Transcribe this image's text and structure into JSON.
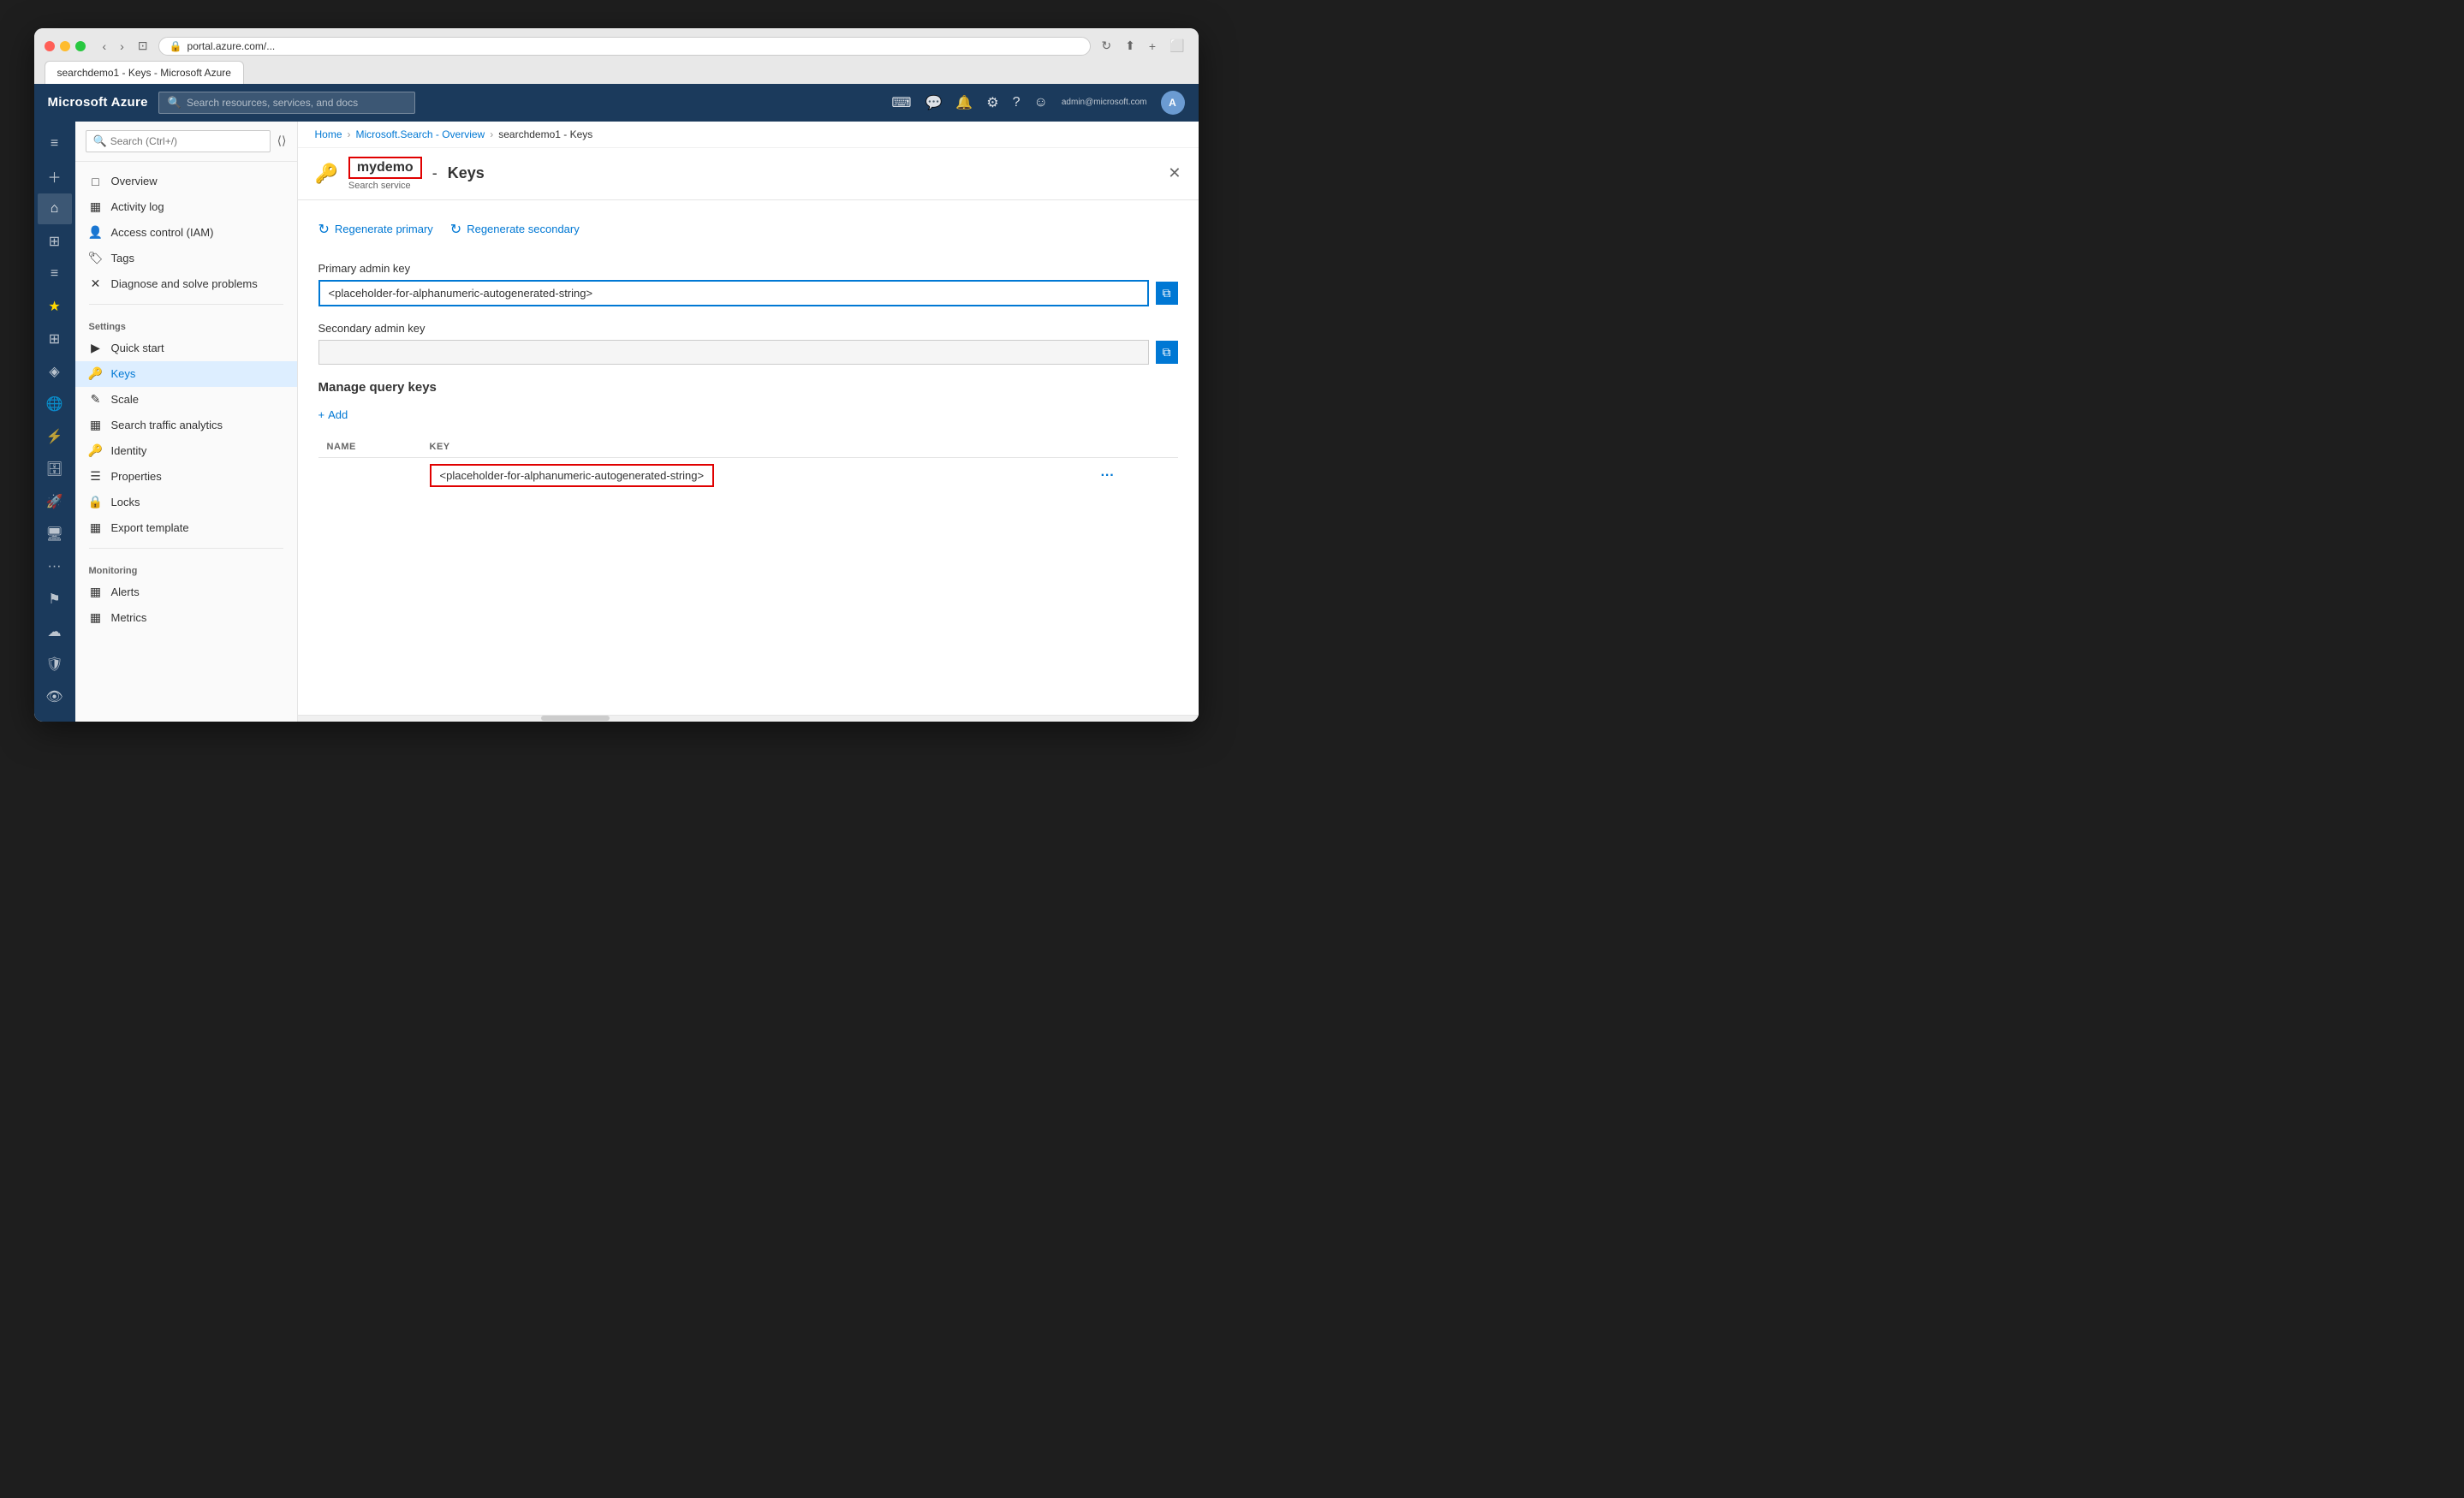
{
  "browser": {
    "url": "portal.azure.com/...",
    "tab_label": "searchdemo1 - Keys - Microsoft Azure"
  },
  "topnav": {
    "logo": "Microsoft Azure",
    "search_placeholder": "Search resources, services, and docs",
    "user_initials": "A",
    "user_email": "admin@microsoft.com"
  },
  "breadcrumb": {
    "items": [
      "Home",
      "Microsoft.Search - Overview",
      "searchdemo1 - Keys"
    ]
  },
  "page_header": {
    "service_name": "mydemo",
    "service_subtitle": "Search service",
    "dash": "-",
    "section": "Keys"
  },
  "toolbar": {
    "regen_primary": "Regenerate primary",
    "regen_secondary": "Regenerate secondary"
  },
  "primary_key_label": "Primary admin key",
  "primary_key_value": "<placeholder-for-alphanumeric-autogenerated-string>",
  "secondary_key_label": "Secondary admin key",
  "secondary_key_value": "",
  "manage_section_title": "Manage query keys",
  "add_button_label": "+ Add",
  "table": {
    "col_name": "NAME",
    "col_key": "KEY",
    "rows": [
      {
        "name": "",
        "key": "<placeholder-for-alphanumeric-autogenerated-string>"
      }
    ]
  },
  "sidebar": {
    "search_placeholder": "Search (Ctrl+/)",
    "nav_items": [
      {
        "id": "overview",
        "label": "Overview",
        "icon": "□"
      },
      {
        "id": "activity-log",
        "label": "Activity log",
        "icon": "▦"
      },
      {
        "id": "access-control",
        "label": "Access control (IAM)",
        "icon": "👤"
      },
      {
        "id": "tags",
        "label": "Tags",
        "icon": "🏷"
      },
      {
        "id": "diagnose",
        "label": "Diagnose and solve problems",
        "icon": "✕"
      }
    ],
    "settings_label": "Settings",
    "settings_items": [
      {
        "id": "quick-start",
        "label": "Quick start",
        "icon": "▶"
      },
      {
        "id": "keys",
        "label": "Keys",
        "icon": "🔑",
        "active": true
      },
      {
        "id": "scale",
        "label": "Scale",
        "icon": "✎"
      },
      {
        "id": "search-traffic",
        "label": "Search traffic analytics",
        "icon": "▦"
      },
      {
        "id": "identity",
        "label": "Identity",
        "icon": "🔑"
      },
      {
        "id": "properties",
        "label": "Properties",
        "icon": "☰"
      },
      {
        "id": "locks",
        "label": "Locks",
        "icon": "🔒"
      },
      {
        "id": "export-template",
        "label": "Export template",
        "icon": "▦"
      }
    ],
    "monitoring_label": "Monitoring",
    "monitoring_items": [
      {
        "id": "alerts",
        "label": "Alerts",
        "icon": "▦"
      },
      {
        "id": "metrics",
        "label": "Metrics",
        "icon": "▦"
      }
    ]
  },
  "icon_rail": {
    "icons": [
      {
        "id": "hamburger",
        "glyph": "≡"
      },
      {
        "id": "plus",
        "glyph": "＋"
      },
      {
        "id": "home",
        "glyph": "⌂"
      },
      {
        "id": "dashboard",
        "glyph": "⊞"
      },
      {
        "id": "menu",
        "glyph": "≡"
      },
      {
        "id": "star",
        "glyph": "★"
      },
      {
        "id": "grid",
        "glyph": "⊞"
      },
      {
        "id": "cube",
        "glyph": "◈"
      },
      {
        "id": "globe",
        "glyph": "🌐"
      },
      {
        "id": "lightning",
        "glyph": "⚡"
      },
      {
        "id": "database",
        "glyph": "🗄"
      },
      {
        "id": "rocket",
        "glyph": "🚀"
      },
      {
        "id": "monitor",
        "glyph": "🖥"
      },
      {
        "id": "dots",
        "glyph": "···"
      },
      {
        "id": "flag",
        "glyph": "⚑"
      },
      {
        "id": "cloud",
        "glyph": "☁"
      },
      {
        "id": "shield",
        "glyph": "🛡"
      },
      {
        "id": "eye",
        "glyph": "👁"
      }
    ]
  }
}
